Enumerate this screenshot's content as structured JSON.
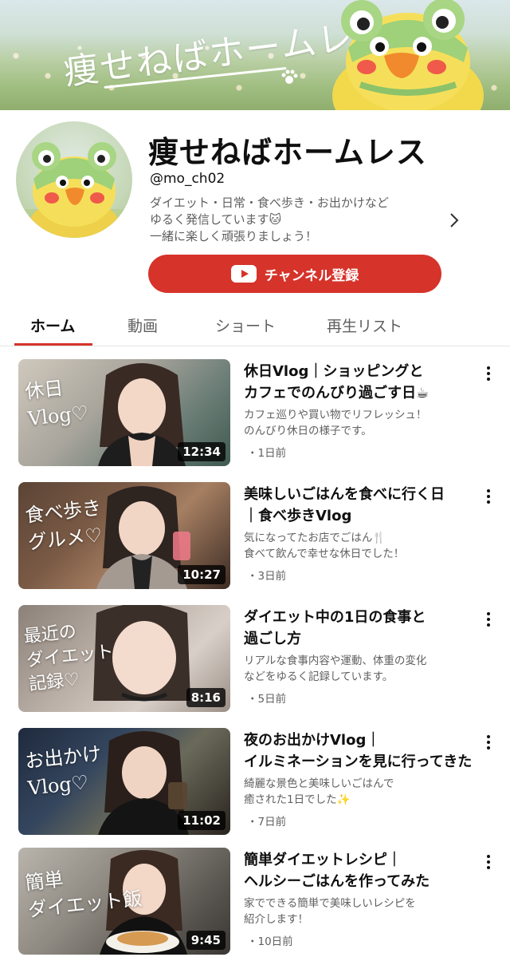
{
  "banner": {
    "title": "痩せねばホームレス"
  },
  "channel": {
    "name": "痩せねばホームレス",
    "handle": "@mo_ch02",
    "description": [
      "ダイエット・日常・食べ歩き・お出かけなど",
      "ゆるく発信しています🐱",
      "一緒に楽しく頑張りましょう！"
    ],
    "subscribe_label": "チャンネル登録"
  },
  "tabs": [
    {
      "label": "ホーム",
      "active": true
    },
    {
      "label": "動画",
      "active": false
    },
    {
      "label": "ショート",
      "active": false
    },
    {
      "label": "再生リスト",
      "active": false
    }
  ],
  "videos": [
    {
      "thumb_text": [
        "休日",
        "Vlog♡"
      ],
      "duration": "12:34",
      "title": [
        "休日Vlog｜ショッピングと",
        "カフェでのんびり過ごす日☕"
      ],
      "desc": [
        "カフェ巡りや買い物でリフレッシュ！",
        "のんびり休日の様子です。"
      ],
      "age": "・1日前"
    },
    {
      "thumb_text": [
        "食べ歩き",
        "グルメ♡"
      ],
      "duration": "10:27",
      "title": [
        "美味しいごはんを食べに行く日",
        "｜食べ歩きVlog"
      ],
      "desc": [
        "気になってたお店でごはん🍴",
        "食べて飲んで幸せな休日でした！"
      ],
      "age": "・3日前"
    },
    {
      "thumb_text": [
        "最近の",
        "ダイエット",
        "記録♡"
      ],
      "duration": "8:16",
      "title": [
        "ダイエット中の1日の食事と",
        "過ごし方"
      ],
      "desc": [
        "リアルな食事内容や運動、体重の変化",
        "などをゆるく記録しています。"
      ],
      "age": "・5日前"
    },
    {
      "thumb_text": [
        "お出かけ",
        "Vlog♡"
      ],
      "duration": "11:02",
      "title": [
        "夜のお出かけVlog｜",
        "イルミネーションを見に行ってきた"
      ],
      "desc": [
        "綺麗な景色と美味しいごはんで",
        "癒された1日でした✨"
      ],
      "age": "・7日前"
    },
    {
      "thumb_text": [
        "簡単",
        "ダイエット飯"
      ],
      "duration": "9:45",
      "title": [
        "簡単ダイエットレシピ｜",
        "ヘルシーごはんを作ってみた"
      ],
      "desc": [
        "家でできる簡単で美味しいレシピを",
        "紹介します！"
      ],
      "age": "・10日前"
    }
  ],
  "colors": {
    "accent": "#d6332a",
    "text": "#0f0f0f",
    "secondary": "#606060"
  }
}
